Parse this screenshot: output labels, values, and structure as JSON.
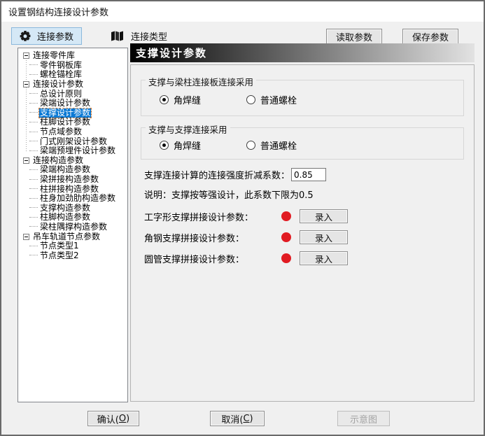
{
  "window": {
    "title": "设置钢结构连接设计参数"
  },
  "toolbar": {
    "tabs": [
      {
        "label": "连接参数",
        "icon": "gear-icon",
        "active": true
      },
      {
        "label": "连接类型",
        "icon": "book-icon",
        "active": false
      }
    ],
    "read_label": "读取参数",
    "save_label": "保存参数"
  },
  "tree": {
    "items": [
      {
        "label": "连接零件库",
        "level": 0,
        "parent": true
      },
      {
        "label": "零件钢板库",
        "level": 1
      },
      {
        "label": "螺栓锚栓库",
        "level": 1
      },
      {
        "label": "连接设计参数",
        "level": 0,
        "parent": true
      },
      {
        "label": "总设计原则",
        "level": 1
      },
      {
        "label": "梁端设计参数",
        "level": 1
      },
      {
        "label": "支撑设计参数",
        "level": 1,
        "selected": true
      },
      {
        "label": "柱脚设计参数",
        "level": 1
      },
      {
        "label": "节点域参数",
        "level": 1
      },
      {
        "label": "门式刚架设计参数",
        "level": 1
      },
      {
        "label": "梁端预埋件设计参数",
        "level": 1
      },
      {
        "label": "连接构造参数",
        "level": 0,
        "parent": true
      },
      {
        "label": "梁端构造参数",
        "level": 1
      },
      {
        "label": "梁拼接构造参数",
        "level": 1
      },
      {
        "label": "柱拼接构造参数",
        "level": 1
      },
      {
        "label": "柱身加劲肋构造参数",
        "level": 1
      },
      {
        "label": "支撑构造参数",
        "level": 1
      },
      {
        "label": "柱脚构造参数",
        "level": 1
      },
      {
        "label": "梁柱隅撑构造参数",
        "level": 1
      },
      {
        "label": "吊车轨道节点参数",
        "level": 0,
        "parent": true
      },
      {
        "label": "节点类型1",
        "level": 1
      },
      {
        "label": "节点类型2",
        "level": 1
      }
    ]
  },
  "panel": {
    "header": "支撑设计参数",
    "groups": [
      {
        "title": "支撑与梁柱连接板连接采用",
        "options": [
          {
            "label": "角焊缝",
            "selected": true
          },
          {
            "label": "普通螺栓",
            "selected": false
          }
        ]
      },
      {
        "title": "支撑与支撑连接采用",
        "options": [
          {
            "label": "角焊缝",
            "selected": true
          },
          {
            "label": "普通螺栓",
            "selected": false
          }
        ]
      }
    ],
    "factor": {
      "label": "支撑连接计算的连接强度折减系数：",
      "value": "0.85"
    },
    "note": "说明：支撑按等强设计，此系数下限为0.5",
    "entries": [
      {
        "label": "工字形支撑拼接设计参数：",
        "button": "录入"
      },
      {
        "label": "角钢支撑拼接设计参数：",
        "button": "录入"
      },
      {
        "label": "圆管支撑拼接设计参数：",
        "button": "录入"
      }
    ]
  },
  "footer": {
    "ok": {
      "pre": "确认(",
      "key": "O",
      "post": ")"
    },
    "cancel": {
      "pre": "取消(",
      "key": "C",
      "post": ")"
    },
    "diagram_label": "示意图"
  },
  "colors": {
    "selection_blue": "#0b79d4",
    "status_red": "#e11b22",
    "tab_active_bg": "#d5e8f6",
    "tab_active_border": "#8ab8dc",
    "header_grad_start": "#000000",
    "header_grad_end": "#e2e2e2"
  }
}
